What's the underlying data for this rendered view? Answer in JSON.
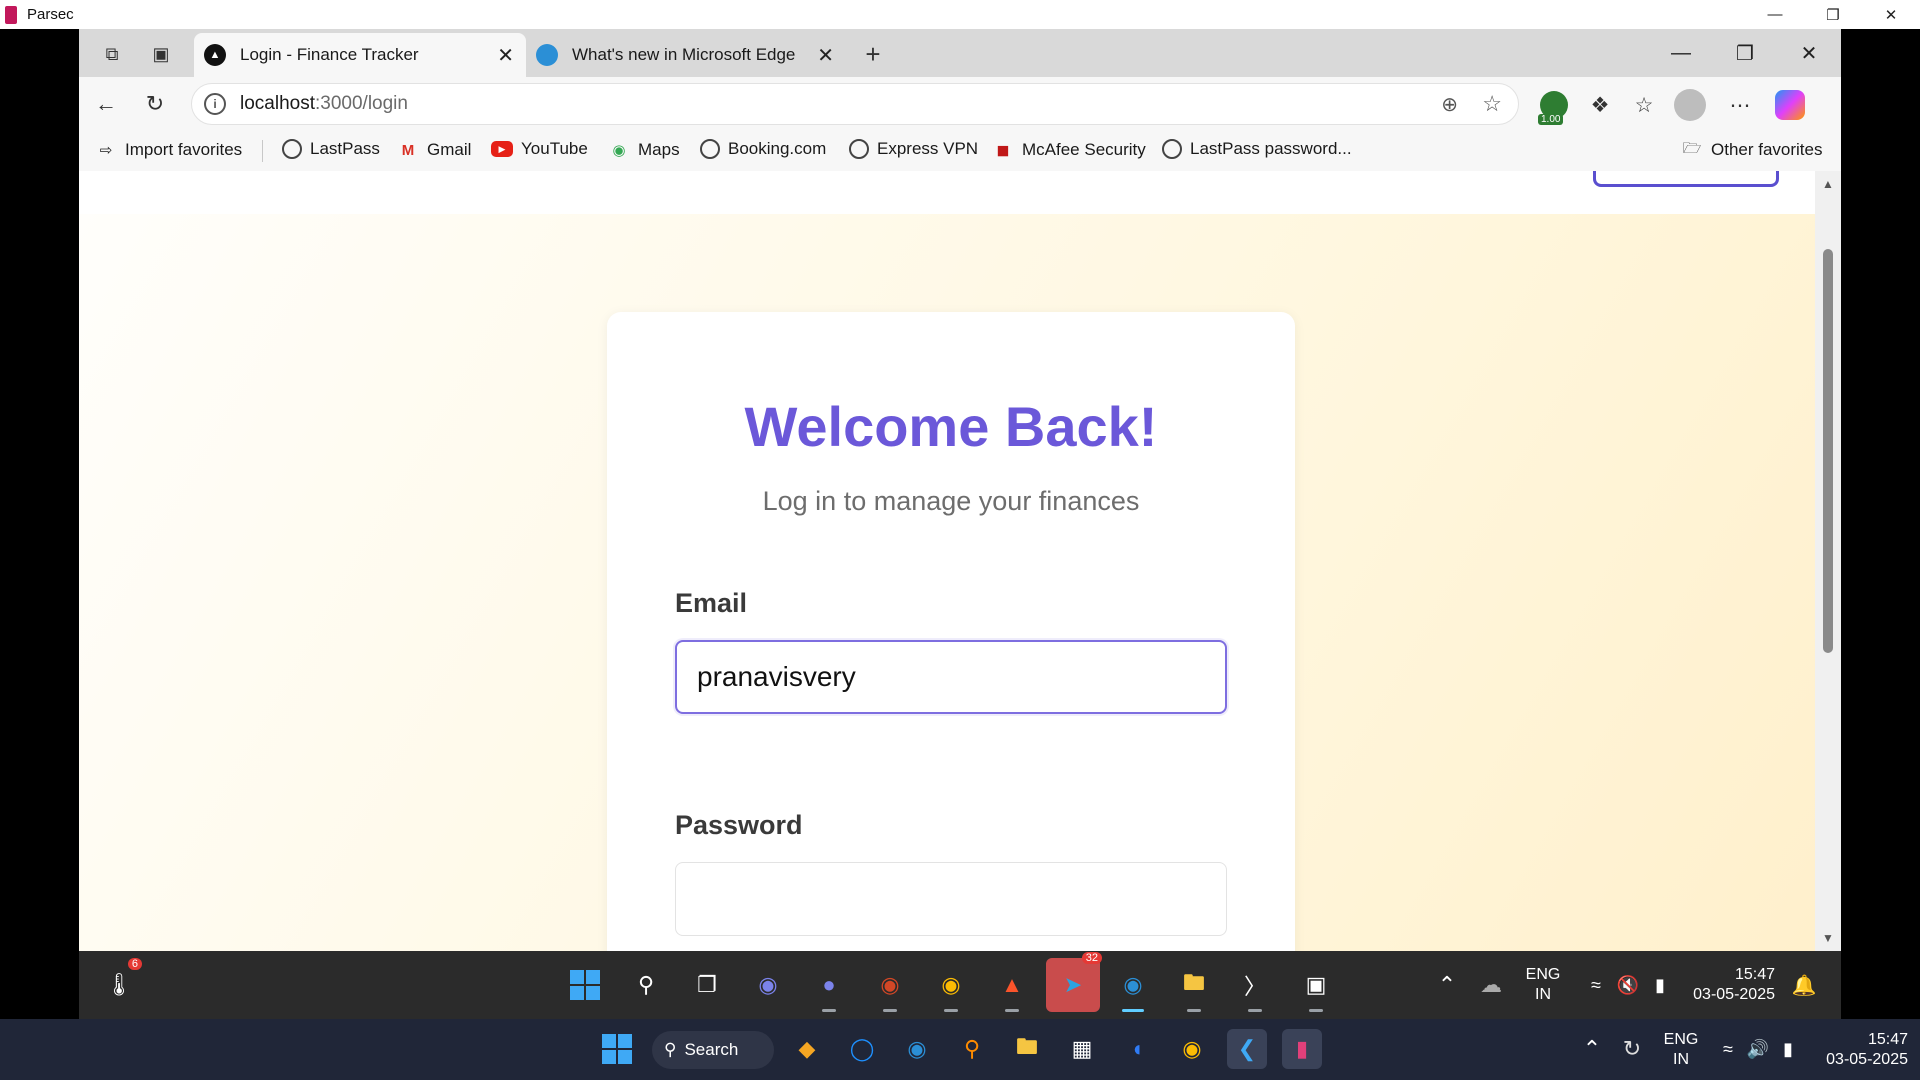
{
  "parsec": {
    "title": "Parsec"
  },
  "tabs": [
    {
      "label": "Login - Finance Tracker"
    },
    {
      "label": "What's new in Microsoft Edge"
    }
  ],
  "address": {
    "host": "localhost",
    "path": ":3000/login"
  },
  "extension_badge": "1.00",
  "favorites": {
    "import": "Import favorites",
    "items": [
      "LastPass",
      "Gmail",
      "YouTube",
      "Maps",
      "Booking.com",
      "Express VPN",
      "McAfee Security",
      "LastPass password..."
    ],
    "other": "Other favorites"
  },
  "login": {
    "title": "Welcome Back!",
    "subtitle": "Log in to manage your finances",
    "email_label": "Email",
    "email_value": "pranavisvery",
    "password_label": "Password",
    "password_value": ""
  },
  "remote_taskbar": {
    "weather_badge": "6",
    "telegram_badge": "32",
    "lang": "ENG",
    "region": "IN",
    "time": "15:47",
    "date": "03-05-2025"
  },
  "local_taskbar": {
    "search_label": "Search",
    "lang": "ENG",
    "region": "IN",
    "time": "15:47",
    "date": "03-05-2025"
  },
  "colors": {
    "accent": "#6b58d9",
    "focus_border": "#7e6ee0",
    "page_bg": "#fff7df"
  }
}
